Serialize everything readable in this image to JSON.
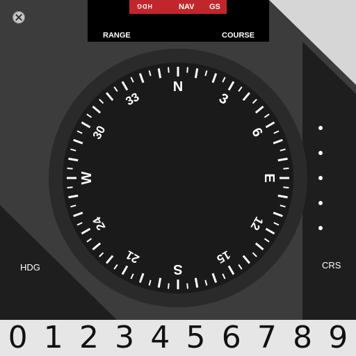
{
  "header": {
    "flags": {
      "hdg": "HDG",
      "nav": "NAV",
      "gs": "GS"
    },
    "range_label": "RANGE",
    "course_label": "COURSE"
  },
  "compass": {
    "labels": [
      {
        "text": "N",
        "heading": 0
      },
      {
        "text": "3",
        "heading": 30
      },
      {
        "text": "6",
        "heading": 60
      },
      {
        "text": "E",
        "heading": 90
      },
      {
        "text": "12",
        "heading": 120
      },
      {
        "text": "15",
        "heading": 150
      },
      {
        "text": "S",
        "heading": 180
      },
      {
        "text": "21",
        "heading": 210
      },
      {
        "text": "24",
        "heading": 240
      },
      {
        "text": "W",
        "heading": 270
      },
      {
        "text": "30",
        "heading": 300
      },
      {
        "text": "33",
        "heading": 330
      }
    ]
  },
  "side_labels": {
    "hdg": "HDG",
    "crs": "CRS"
  },
  "keypad": {
    "digits": [
      "0",
      "1",
      "2",
      "3",
      "4",
      "5",
      "6",
      "7",
      "8",
      "9"
    ]
  },
  "colors": {
    "flag_red": "#c0262c",
    "bezel": "#3c3c3c",
    "card": "#1a1a1a"
  }
}
